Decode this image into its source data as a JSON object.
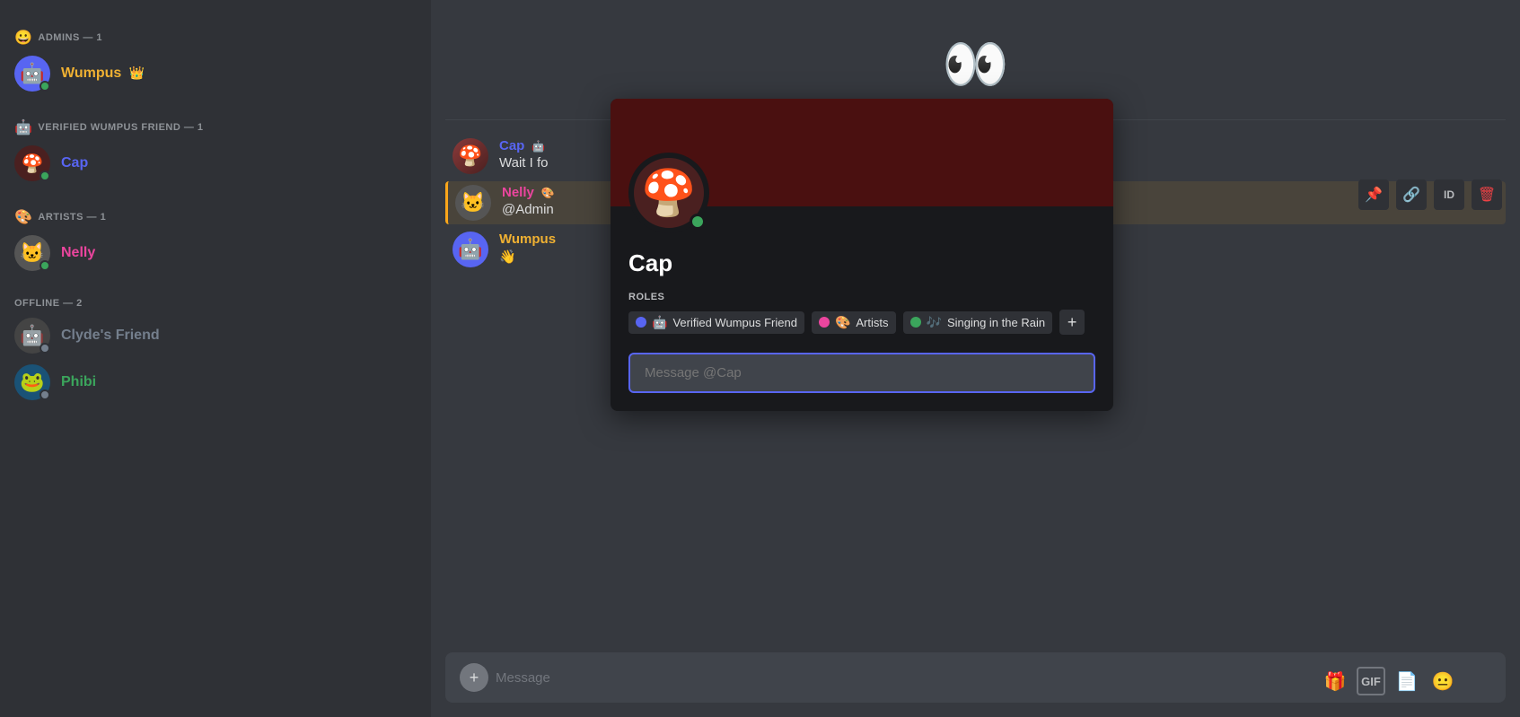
{
  "sidebar": {
    "sections": [
      {
        "id": "admins",
        "label": "ADMINS — 1",
        "icon": "😀",
        "members": [
          {
            "id": "wumpus",
            "name": "Wumpus",
            "nameClass": "name-wumpus",
            "avatarEmoji": "🤖",
            "avatarBg": "#5865f2",
            "status": "online",
            "hasCrown": true,
            "crownEmoji": "👑"
          }
        ]
      },
      {
        "id": "verified-wumpus-friend",
        "label": "VERIFIED WUMPUS FRIEND — 1",
        "icon": "🤖",
        "members": [
          {
            "id": "cap",
            "name": "Cap",
            "nameClass": "name-cap",
            "avatarEmoji": "🍄",
            "avatarBg": "#4a2020",
            "status": "online",
            "hasCrown": false,
            "crownEmoji": ""
          }
        ]
      },
      {
        "id": "artists",
        "label": "ARTISTS — 1",
        "icon": "🎨",
        "members": [
          {
            "id": "nelly",
            "name": "Nelly",
            "nameClass": "name-nelly",
            "avatarEmoji": "🐱",
            "avatarBg": "#555",
            "status": "online",
            "hasCrown": false,
            "crownEmoji": ""
          }
        ]
      }
    ],
    "offline_section": {
      "label": "OFFLINE — 2",
      "members": [
        {
          "id": "clydes-friend",
          "name": "Clyde's Friend",
          "nameClass": "name-clyde",
          "avatarEmoji": "🤖",
          "avatarBg": "#444",
          "status": "offline"
        },
        {
          "id": "phibi",
          "name": "Phibi",
          "nameClass": "name-phibi",
          "avatarEmoji": "🐸",
          "avatarBg": "#1a5276",
          "status": "offline"
        }
      ]
    }
  },
  "chat": {
    "top_decoration": "👀",
    "messages": [
      {
        "id": "msg-cap",
        "username": "Cap",
        "usernameClass": "cap-color",
        "avatarEmoji": "🍄",
        "avatarBg": "#4a2020",
        "badge": "🤖",
        "text": "Wait I fo",
        "truncated": true
      },
      {
        "id": "msg-nelly",
        "username": "Nelly",
        "usernameClass": "nelly-color",
        "avatarEmoji": "🐱",
        "avatarBg": "#555",
        "badge": "🎨",
        "text": "@Admin",
        "truncated": true,
        "highlighted": true
      },
      {
        "id": "msg-wumpus",
        "username": "Wumpus",
        "usernameClass": "wumpus-color",
        "avatarEmoji": "🤖",
        "avatarBg": "#5865f2",
        "badge": "",
        "text": "👋",
        "truncated": false
      }
    ],
    "input_placeholder": "Message"
  },
  "popup": {
    "username": "Cap",
    "roles_label": "ROLES",
    "roles": [
      {
        "id": "role-verified",
        "dot_color": "role-dot-blue",
        "icon": "🤖",
        "label": "Verified Wumpus Friend"
      },
      {
        "id": "role-artists",
        "dot_color": "role-dot-pink",
        "icon": "🎨",
        "label": "Artists"
      },
      {
        "id": "role-singing",
        "dot_color": "role-dot-green",
        "icon": "🎶",
        "label": "Singing in the Rain"
      }
    ],
    "add_role_label": "+",
    "message_placeholder": "Message @Cap"
  },
  "toolbar": {
    "icons": [
      {
        "id": "pin-icon",
        "symbol": "📌",
        "label": "Pin"
      },
      {
        "id": "link-icon",
        "symbol": "🔗",
        "label": "Link"
      },
      {
        "id": "id-button",
        "label": "ID"
      },
      {
        "id": "delete-icon",
        "symbol": "🗑",
        "label": "Delete",
        "red": true
      }
    ]
  },
  "bottom_icons": [
    {
      "id": "gift-icon",
      "symbol": "🎁",
      "label": "Gift"
    },
    {
      "id": "gif-icon",
      "label": "GIF"
    },
    {
      "id": "sticker-icon",
      "symbol": "📄",
      "label": "Sticker"
    },
    {
      "id": "emoji-icon",
      "symbol": "😐",
      "label": "Emoji"
    }
  ]
}
